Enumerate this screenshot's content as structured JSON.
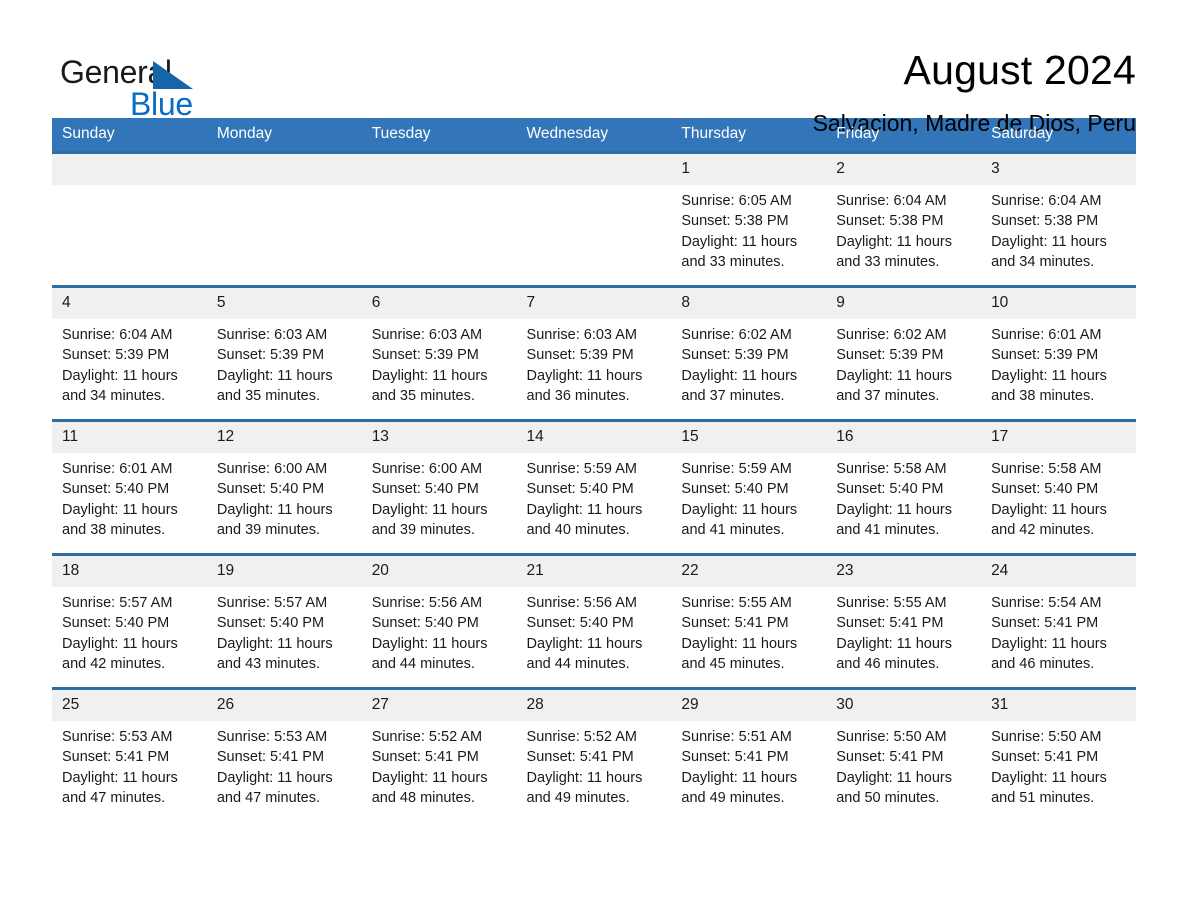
{
  "brand": {
    "name_first": "General",
    "name_second": "Blue",
    "triangle_icon": "triangle-icon"
  },
  "header": {
    "title": "August 2024",
    "location": "Salvacion, Madre de Dios, Peru"
  },
  "calendar": {
    "weekday_headers": [
      "Sunday",
      "Monday",
      "Tuesday",
      "Wednesday",
      "Thursday",
      "Friday",
      "Saturday"
    ],
    "labels": {
      "sunrise": "Sunrise:",
      "sunset": "Sunset:",
      "daylight": "Daylight:"
    },
    "weeks": [
      [
        {
          "day": "",
          "empty": true
        },
        {
          "day": "",
          "empty": true
        },
        {
          "day": "",
          "empty": true
        },
        {
          "day": "",
          "empty": true
        },
        {
          "day": "1",
          "sunrise": "Sunrise: 6:05 AM",
          "sunset": "Sunset: 5:38 PM",
          "daylight": "Daylight: 11 hours and 33 minutes."
        },
        {
          "day": "2",
          "sunrise": "Sunrise: 6:04 AM",
          "sunset": "Sunset: 5:38 PM",
          "daylight": "Daylight: 11 hours and 33 minutes."
        },
        {
          "day": "3",
          "sunrise": "Sunrise: 6:04 AM",
          "sunset": "Sunset: 5:38 PM",
          "daylight": "Daylight: 11 hours and 34 minutes."
        }
      ],
      [
        {
          "day": "4",
          "sunrise": "Sunrise: 6:04 AM",
          "sunset": "Sunset: 5:39 PM",
          "daylight": "Daylight: 11 hours and 34 minutes."
        },
        {
          "day": "5",
          "sunrise": "Sunrise: 6:03 AM",
          "sunset": "Sunset: 5:39 PM",
          "daylight": "Daylight: 11 hours and 35 minutes."
        },
        {
          "day": "6",
          "sunrise": "Sunrise: 6:03 AM",
          "sunset": "Sunset: 5:39 PM",
          "daylight": "Daylight: 11 hours and 35 minutes."
        },
        {
          "day": "7",
          "sunrise": "Sunrise: 6:03 AM",
          "sunset": "Sunset: 5:39 PM",
          "daylight": "Daylight: 11 hours and 36 minutes."
        },
        {
          "day": "8",
          "sunrise": "Sunrise: 6:02 AM",
          "sunset": "Sunset: 5:39 PM",
          "daylight": "Daylight: 11 hours and 37 minutes."
        },
        {
          "day": "9",
          "sunrise": "Sunrise: 6:02 AM",
          "sunset": "Sunset: 5:39 PM",
          "daylight": "Daylight: 11 hours and 37 minutes."
        },
        {
          "day": "10",
          "sunrise": "Sunrise: 6:01 AM",
          "sunset": "Sunset: 5:39 PM",
          "daylight": "Daylight: 11 hours and 38 minutes."
        }
      ],
      [
        {
          "day": "11",
          "sunrise": "Sunrise: 6:01 AM",
          "sunset": "Sunset: 5:40 PM",
          "daylight": "Daylight: 11 hours and 38 minutes."
        },
        {
          "day": "12",
          "sunrise": "Sunrise: 6:00 AM",
          "sunset": "Sunset: 5:40 PM",
          "daylight": "Daylight: 11 hours and 39 minutes."
        },
        {
          "day": "13",
          "sunrise": "Sunrise: 6:00 AM",
          "sunset": "Sunset: 5:40 PM",
          "daylight": "Daylight: 11 hours and 39 minutes."
        },
        {
          "day": "14",
          "sunrise": "Sunrise: 5:59 AM",
          "sunset": "Sunset: 5:40 PM",
          "daylight": "Daylight: 11 hours and 40 minutes."
        },
        {
          "day": "15",
          "sunrise": "Sunrise: 5:59 AM",
          "sunset": "Sunset: 5:40 PM",
          "daylight": "Daylight: 11 hours and 41 minutes."
        },
        {
          "day": "16",
          "sunrise": "Sunrise: 5:58 AM",
          "sunset": "Sunset: 5:40 PM",
          "daylight": "Daylight: 11 hours and 41 minutes."
        },
        {
          "day": "17",
          "sunrise": "Sunrise: 5:58 AM",
          "sunset": "Sunset: 5:40 PM",
          "daylight": "Daylight: 11 hours and 42 minutes."
        }
      ],
      [
        {
          "day": "18",
          "sunrise": "Sunrise: 5:57 AM",
          "sunset": "Sunset: 5:40 PM",
          "daylight": "Daylight: 11 hours and 42 minutes."
        },
        {
          "day": "19",
          "sunrise": "Sunrise: 5:57 AM",
          "sunset": "Sunset: 5:40 PM",
          "daylight": "Daylight: 11 hours and 43 minutes."
        },
        {
          "day": "20",
          "sunrise": "Sunrise: 5:56 AM",
          "sunset": "Sunset: 5:40 PM",
          "daylight": "Daylight: 11 hours and 44 minutes."
        },
        {
          "day": "21",
          "sunrise": "Sunrise: 5:56 AM",
          "sunset": "Sunset: 5:40 PM",
          "daylight": "Daylight: 11 hours and 44 minutes."
        },
        {
          "day": "22",
          "sunrise": "Sunrise: 5:55 AM",
          "sunset": "Sunset: 5:41 PM",
          "daylight": "Daylight: 11 hours and 45 minutes."
        },
        {
          "day": "23",
          "sunrise": "Sunrise: 5:55 AM",
          "sunset": "Sunset: 5:41 PM",
          "daylight": "Daylight: 11 hours and 46 minutes."
        },
        {
          "day": "24",
          "sunrise": "Sunrise: 5:54 AM",
          "sunset": "Sunset: 5:41 PM",
          "daylight": "Daylight: 11 hours and 46 minutes."
        }
      ],
      [
        {
          "day": "25",
          "sunrise": "Sunrise: 5:53 AM",
          "sunset": "Sunset: 5:41 PM",
          "daylight": "Daylight: 11 hours and 47 minutes."
        },
        {
          "day": "26",
          "sunrise": "Sunrise: 5:53 AM",
          "sunset": "Sunset: 5:41 PM",
          "daylight": "Daylight: 11 hours and 47 minutes."
        },
        {
          "day": "27",
          "sunrise": "Sunrise: 5:52 AM",
          "sunset": "Sunset: 5:41 PM",
          "daylight": "Daylight: 11 hours and 48 minutes."
        },
        {
          "day": "28",
          "sunrise": "Sunrise: 5:52 AM",
          "sunset": "Sunset: 5:41 PM",
          "daylight": "Daylight: 11 hours and 49 minutes."
        },
        {
          "day": "29",
          "sunrise": "Sunrise: 5:51 AM",
          "sunset": "Sunset: 5:41 PM",
          "daylight": "Daylight: 11 hours and 49 minutes."
        },
        {
          "day": "30",
          "sunrise": "Sunrise: 5:50 AM",
          "sunset": "Sunset: 5:41 PM",
          "daylight": "Daylight: 11 hours and 50 minutes."
        },
        {
          "day": "31",
          "sunrise": "Sunrise: 5:50 AM",
          "sunset": "Sunset: 5:41 PM",
          "daylight": "Daylight: 11 hours and 51 minutes."
        }
      ]
    ]
  },
  "colors": {
    "header_blue": "#3275b8",
    "row_border_blue": "#2e6da4",
    "daynum_gray": "#f0f0f0",
    "brand_blue": "#0a6cc4",
    "brand_triangle_blue": "#1565a8"
  }
}
